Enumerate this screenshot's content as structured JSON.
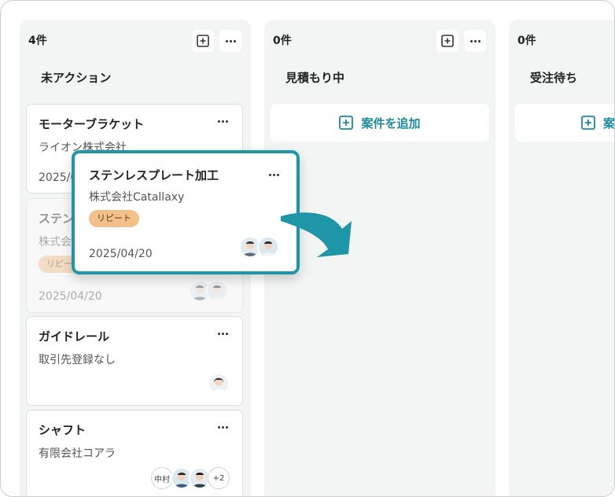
{
  "columns": [
    {
      "count": "4件",
      "title": "未アクション",
      "cards": [
        {
          "title": "モーターブラケット",
          "company": "ライオン株式会社",
          "date": "2025/04/20"
        },
        {
          "title": "ステンレスプレート加工",
          "company": "株式会社Catallaxy",
          "tag": "リピート",
          "date": "2025/04/20"
        },
        {
          "title": "ガイドレール",
          "company": "取引先登録なし"
        },
        {
          "title": "シャフト",
          "company": "有限会社コアラ",
          "avatar_name": "中村",
          "avatar_more": "+2"
        }
      ]
    },
    {
      "count": "0件",
      "title": "見積もり中",
      "add_label": "案件を追加"
    },
    {
      "count": "0件",
      "title": "受注待ち",
      "add_label": "案件を追加"
    }
  ],
  "drag_card": {
    "title": "ステンレスプレート加工",
    "company": "株式会社Catallaxy",
    "tag": "リピート",
    "date": "2025/04/20"
  },
  "colors": {
    "accent": "#1f95a8",
    "tag_bg": "#f3c089",
    "column_bg": "#f3f4f4"
  }
}
